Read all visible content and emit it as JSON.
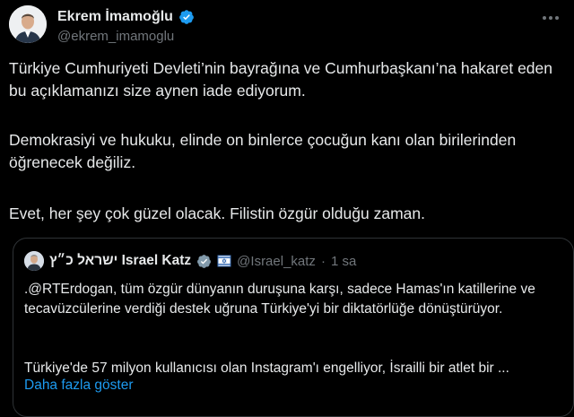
{
  "author": {
    "name": "Ekrem İmamoğlu",
    "handle": "@ekrem_imamoglu"
  },
  "tweet": {
    "paragraphs": [
      "Türkiye Cumhuriyeti Devleti’nin bayrağına ve Cumhurbaşkanı’na hakaret eden bu açıklamanızı size aynen iade ediyorum.",
      "Demokrasiyi ve hukuku, elinde on binlerce çocuğun kanı olan birilerinden öğrenecek değiliz.",
      "Evet, her şey çok güzel olacak. Filistin özgür olduğu zaman."
    ]
  },
  "quote": {
    "name": "ישראל כ״ץ Israel Katz",
    "handle": "@Israel_katz",
    "separator": "·",
    "time": "1 sa",
    "paragraphs": [
      ".@RTErdogan, tüm özgür dünyanın duruşuna karşı, sadece Hamas'ın katillerine ve tecavüzcülerine verdiği destek uğruna Türkiye'yi bir diktatörlüğe dönüştürüyor.",
      "Türkiye'de 57 milyon kullanıcısı olan Instagram'ı engelliyor, İsrailli bir atlet bir ..."
    ],
    "show_more": "Daha fazla göster"
  },
  "colors": {
    "background": "#000000",
    "text": "#e7e9ea",
    "secondary": "#71767b",
    "link": "#1d9bf0",
    "verified": "#1d9bf0",
    "gov_badge": "#829aab"
  },
  "icons": [
    "verified-badge-icon",
    "more-options-icon",
    "gray-verified-badge-icon",
    "israel-flag-icon"
  ]
}
